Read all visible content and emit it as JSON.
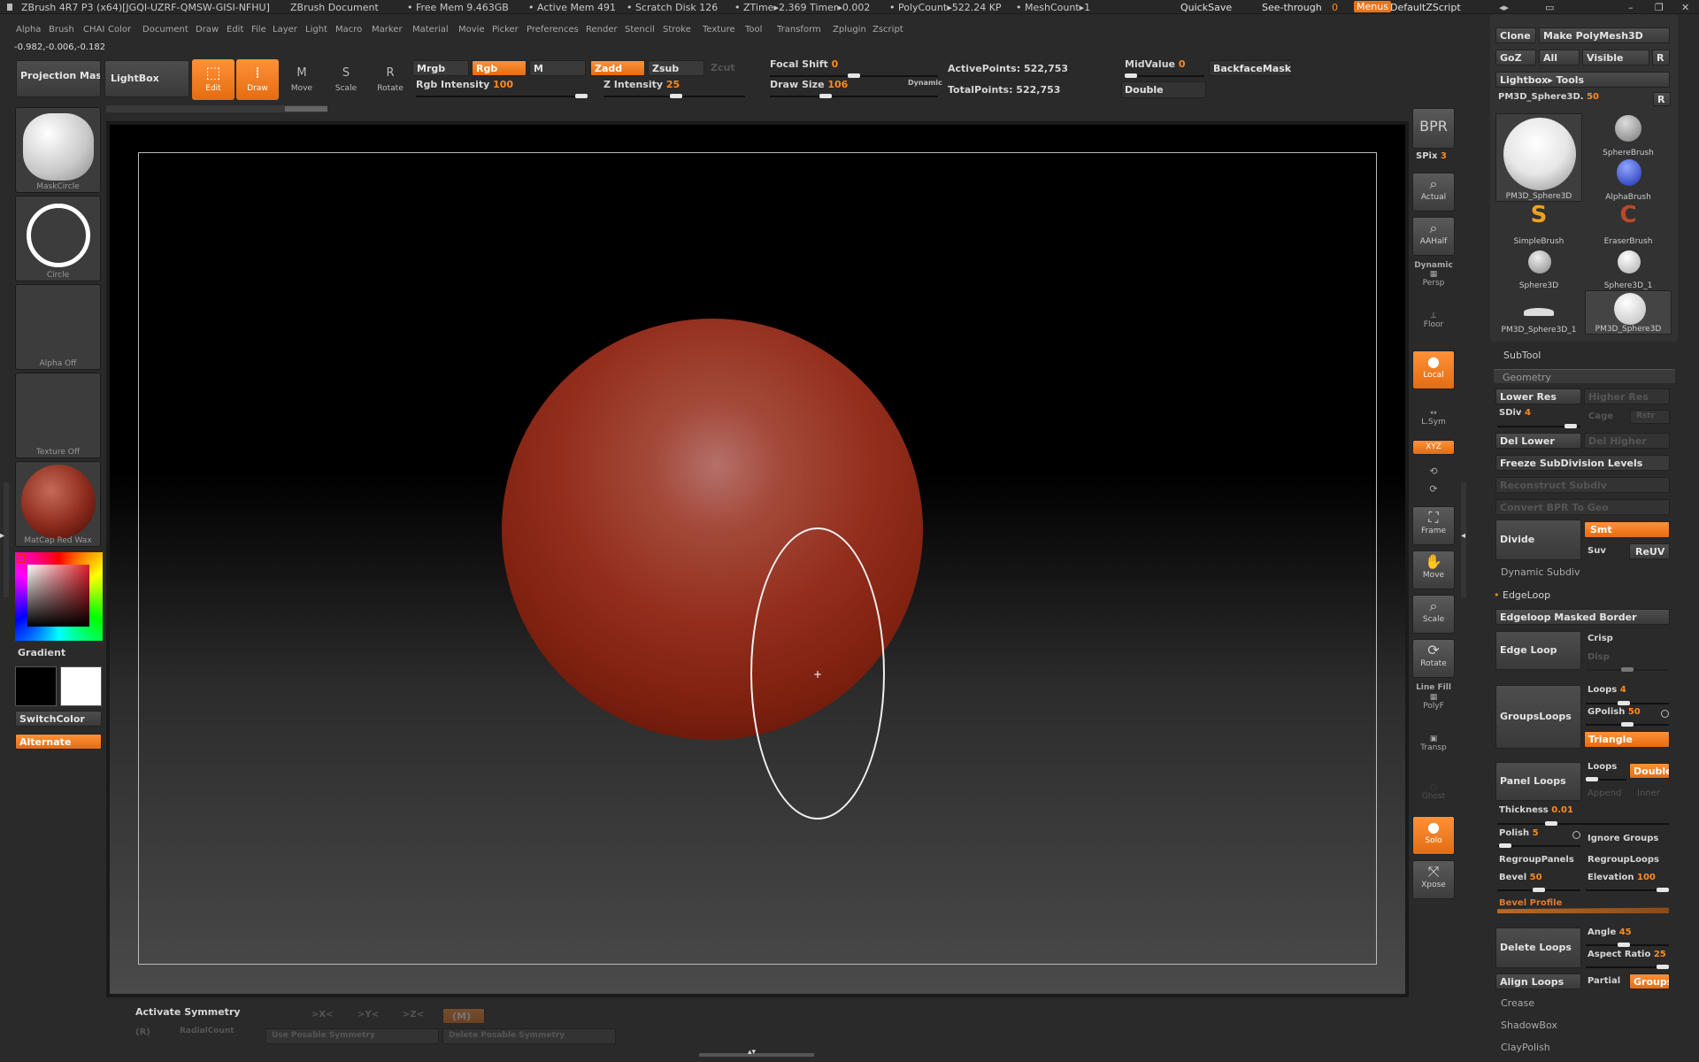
{
  "titlebar": {
    "app": "ZBrush 4R7 P3 (x64)[JGQI-UZRF-QMSW-GISI-NFHU]",
    "doc": "ZBrush Document",
    "free_mem": "• Free Mem 9.463GB",
    "active_mem": "• Active Mem 491",
    "scratch": "• Scratch Disk 126",
    "ztime": "• ZTime▸2.369 Timer▸0.002",
    "poly": "• PolyCount▸522.24 KP",
    "mesh": "• MeshCount▸1",
    "quicksave": "QuickSave",
    "seethrough_label": "See-through",
    "seethrough_value": "0",
    "menus": "Menus",
    "script": "DefaultZScript"
  },
  "menus": [
    "Alpha",
    "Brush",
    "CHAI",
    "Color",
    "Document",
    "Draw",
    "Edit",
    "File",
    "Layer",
    "Light",
    "Macro",
    "Marker",
    "Material",
    "Movie",
    "Picker",
    "Preferences",
    "Render",
    "Stencil",
    "Stroke",
    "Texture",
    "Tool",
    "Transform",
    "Zplugin",
    "Zscript"
  ],
  "coords": "-0.982,-0.006,-0.182",
  "top": {
    "projection_master": "Projection Master",
    "lightbox": "LightBox",
    "edit": "Edit",
    "draw": "Draw",
    "move": "Move",
    "scale": "Scale",
    "rotate": "Rotate",
    "mrgb": "Mrgb",
    "rgb": "Rgb",
    "m": "M",
    "zadd": "Zadd",
    "zsub": "Zsub",
    "zcut": "Zcut",
    "rgb_int_label": "Rgb Intensity",
    "rgb_int": "100",
    "z_int_label": "Z Intensity",
    "z_int": "25",
    "focal_label": "Focal Shift",
    "focal": "0",
    "drawsize_label": "Draw Size",
    "drawsize": "106",
    "dynamic": "Dynamic",
    "active_pts": "ActivePoints: 522,753",
    "total_pts": "TotalPoints: 522,753",
    "mid_label": "MidValue",
    "mid": "0",
    "backface": "BackfaceMask",
    "double": "Double"
  },
  "left": {
    "alpha1": "MaskCircle",
    "alpha2": "Circle",
    "alpha3": "Alpha Off",
    "texture": "Texture Off",
    "material": "MatCap Red Wax",
    "gradient": "Gradient",
    "switch": "SwitchColor",
    "alternate": "Alternate"
  },
  "right_shelf": {
    "bpr": "BPR",
    "spix_label": "SPix",
    "spix": "3",
    "actual": "Actual",
    "aahalf": "AAHalf",
    "dynamic": "Dynamic",
    "persp": "Persp",
    "floor": "Floor",
    "local": "Local",
    "lsym": "L.Sym",
    "xyz": "XYZ",
    "frame": "Frame",
    "move": "Move",
    "scale": "Scale",
    "rotate": "Rotate",
    "linefill": "Line Fill",
    "polyf": "PolyF",
    "transp": "Transp",
    "ghost": "Ghost",
    "solo": "Solo",
    "xpose": "Xpose"
  },
  "bottom": {
    "activate": "Activate Symmetry",
    "x": ">X<",
    "y": ">Y<",
    "z": ">Z<",
    "m": "(M)",
    "r": "(R)",
    "radial": "RadialCount",
    "usepose": "Use Posable Symmetry",
    "delete": "Delete Posable Symmetry"
  },
  "tool": {
    "clone": "Clone",
    "make_poly": "Make PolyMesh3D",
    "r": "R",
    "goz": "GoZ",
    "all": "All",
    "visible": "Visible",
    "lightbox_tools": "Lightbox▸ Tools",
    "current_label": "PM3D_Sphere3D.",
    "current_value": "50",
    "items": [
      "PM3D_Sphere3D",
      "SphereBrush",
      "AlphaBrush",
      "SimpleBrush",
      "EraserBrush",
      "Sphere3D",
      "Sphere3D_1",
      "PM3D_Sphere3D_1",
      "PM3D_Sphere3D"
    ],
    "subtool": "SubTool",
    "geometry": "Geometry",
    "lower_res": "Lower Res",
    "higher_res": "Higher Res",
    "sdiv_label": "SDiv",
    "sdiv": "4",
    "cage": "Cage",
    "rstr": "Rstr",
    "del_lower": "Del Lower",
    "del_higher": "Del Higher",
    "freeze": "Freeze SubDivision Levels",
    "reconstruct": "Reconstruct Subdiv",
    "convert": "Convert BPR To Geo",
    "divide": "Divide",
    "smt": "Smt",
    "suv": "Suv",
    "reuv": "ReUV",
    "dyn_subdiv": "Dynamic Subdiv",
    "edgeloop": "EdgeLoop",
    "edgeloop_masked": "Edgeloop Masked Border",
    "edge_loop": "Edge Loop",
    "crisp": "Crisp",
    "disp": "Disp",
    "groups_loops": "GroupsLoops",
    "loops_label": "Loops",
    "loops": "4",
    "gpolish_label": "GPolish",
    "gpolish": "50",
    "triangle": "Triangle",
    "panel_loops": "Panel Loops",
    "loops2_label": "Loops",
    "double": "Double",
    "append": "Append",
    "inner": "Inner",
    "thickness_label": "Thickness",
    "thickness": "0.01",
    "polish_label": "Polish",
    "polish": "5",
    "ignore_groups": "Ignore Groups",
    "regroup_panels": "RegroupPanels",
    "regroup_loops": "RegroupLoops",
    "bevel_label": "Bevel",
    "bevel": "50",
    "elevation_label": "Elevation",
    "elevation": "100",
    "bevel_profile": "Bevel Profile",
    "delete_loops": "Delete Loops",
    "angle_label": "Angle",
    "angle": "45",
    "aspect_label": "Aspect Ratio",
    "aspect": "25",
    "align_loops": "Align Loops",
    "partial": "Partial",
    "groups": "Groups",
    "crease": "Crease",
    "shadowbox": "ShadowBox",
    "claypolish": "ClayPolish"
  }
}
